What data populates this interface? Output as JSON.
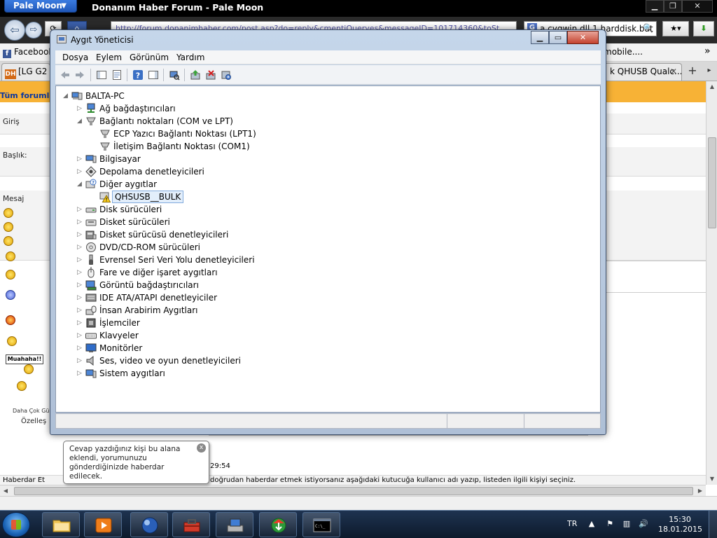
{
  "browser": {
    "menu_label": "Pale Moon",
    "menu_arrow": "▼",
    "window_title": "Donanım Haber Forum - Pale Moon",
    "url": "http://forum.donanimhaber.com/post.asp?do=reply&cmentiQueryes&messageID=101714360&toSt",
    "search_text": "a cygwin dll 1 harddisk.bat",
    "search_engine_icon": "G",
    "bookmark_facebook": "Facebook",
    "bookmark_mobile": "mobile....",
    "tab_left": "[LG G2 R",
    "tab_right": "k QHUSB Qualc...",
    "tab_close": "✕",
    "new_tab": "+"
  },
  "page": {
    "top_link": "Tüm forumlar",
    "row_giris": "Giriş",
    "row_baslik": "Başlık:",
    "row_mesaj": "Mesaj",
    "muahaha": "Muahaha!!",
    "more_smileys": "Daha Çok Gü",
    "ozel": "Özelleş",
    "timestamp": "29:54",
    "haberdar_label": "Haberdar Et",
    "haberdar_desc": "doğrudan haberdar etmek istiyorsanız aşağıdaki kutucuğa kullanıcı adı yazıp, listeden ilgili kişiyi seçiniz."
  },
  "tooltip": {
    "text": "Cevap yazdığınız kişi bu alana eklendi, yorumunuzu gönderdiğinizde haberdar edilecek.",
    "close": "x"
  },
  "device_manager": {
    "title": "Aygıt Yöneticisi",
    "menus": [
      "Dosya",
      "Eylem",
      "Görünüm",
      "Yardım"
    ],
    "root": "BALTA-PC",
    "categories": [
      "Ağ bağdaştırıcıları",
      "Bağlantı noktaları (COM ve LPT)",
      "Bilgisayar",
      "Depolama denetleyicileri",
      "Diğer aygıtlar",
      "Disk sürücüleri",
      "Disket sürücüleri",
      "Disket sürücüsü denetleyicileri",
      "DVD/CD-ROM sürücüleri",
      "Evrensel Seri Veri Yolu denetleyicileri",
      "Fare ve diğer işaret aygıtları",
      "Görüntü bağdaştırıcıları",
      "IDE ATA/ATAPI denetleyiciler",
      "İnsan Arabirim Aygıtları",
      "İşlemciler",
      "Klavyeler",
      "Monitörler",
      "Ses, video ve oyun denetleyicileri",
      "Sistem aygıtları"
    ],
    "ports_children": [
      "ECP Yazıcı Bağlantı Noktası (LPT1)",
      "İletişim Bağlantı Noktası (COM1)"
    ],
    "other_children": [
      "QHSUSB__BULK"
    ]
  },
  "taskbar": {
    "language": "TR",
    "time": "15:30",
    "date": "18.01.2015",
    "cmd_label": "C:\\_"
  },
  "colors": {
    "orange": "#f7b236",
    "link_blue": "#0a37a0",
    "selection_bg": "#e2eefb"
  }
}
